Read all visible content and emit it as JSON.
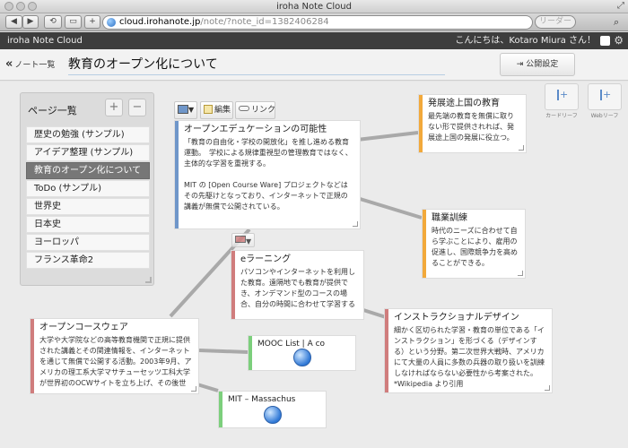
{
  "browser": {
    "window_title": "iroha Note Cloud",
    "url_host": "cloud.irohanote.jp",
    "url_path": "/note/?note_id=1382406284",
    "reader_label": "リーダー"
  },
  "appbar": {
    "brand": "iroha Note Cloud",
    "greeting": "こんにちは、Kotaro Miura さん！"
  },
  "note": {
    "back_label": "ノート一覧",
    "title": "教育のオープン化について",
    "publish_label": "公開設定"
  },
  "tools": {
    "card_reef": "カードリーフ",
    "web_reef": "Webリーフ"
  },
  "pages": {
    "title": "ページ一覧",
    "add": "+",
    "remove": "−",
    "items": [
      "歴史の勉強 (サンプル)",
      "アイデア整理 (サンプル)",
      "教育のオープン化について",
      "ToDo (サンプル)",
      "世界史",
      "日本史",
      "ヨーロッパ",
      "フランス革命2"
    ],
    "active_index": 2
  },
  "card_controls": {
    "edit": "編集",
    "link": "リンク"
  },
  "cards": {
    "open_education": {
      "title": "オープンエデュケーションの可能性",
      "body": "「教育の自由化・学校の開放化」を推し進める教育運動。　学校による規律重視型の管理教育ではなく、主体的な学習を重視する。\n\nMIT の [Open Course Ware] プロジェクトなどはその先駆けとなっており、インターネットで正規の講義が無償で公開されている。",
      "color": "#6f96c9"
    },
    "developing": {
      "title": "発展途上国の教育",
      "body": "最先端の教育を無償に取りない形で提供されれば、発展途上国の発展に役立つ。",
      "color": "#f2a93b"
    },
    "vocational": {
      "title": "職業訓練",
      "body": "時代のニーズに合わせて自ら学ぶことにより、雇用の促進し、国際競争力を高めることができる。",
      "color": "#f2a93b"
    },
    "elearning": {
      "title": "eラーニング",
      "body": "パソコンやインターネットを利用した教育。遠隔地でも教育が提供でき、オンデマンド型のコースの場合、自分の時間に合わせて学習する",
      "color": "#d07d7d"
    },
    "instructional": {
      "title": "インストラクショナルデザイン",
      "body": "細かく区切られた学習・教育の単位である「インストラクション」を形づくる（デザインする）という分野。第二次世界大戦時、アメリカにて大量の人員に多数の兵器の取り扱いを訓練しなければならない必要性から考案された。\n*Wikipedia より引用",
      "color": "#d07d7d"
    },
    "opencourseware": {
      "title": "オープンコースウェア",
      "body": "大学や大学院などの高等教育機関で正規に提供された講義とその関連情報を、インターネットを通じて無償で公開する活動。2003年9月、アメリカの理工系大学マサチューセッツ工科大学が世界初のOCWサイトを立ち上げ、その後世",
      "color": "#d07d7d"
    },
    "mooc": {
      "title": "MOOC List | A co",
      "color": "#7ccf7c"
    },
    "mit": {
      "title": "MIT – Massachus",
      "color": "#7ccf7c"
    }
  }
}
